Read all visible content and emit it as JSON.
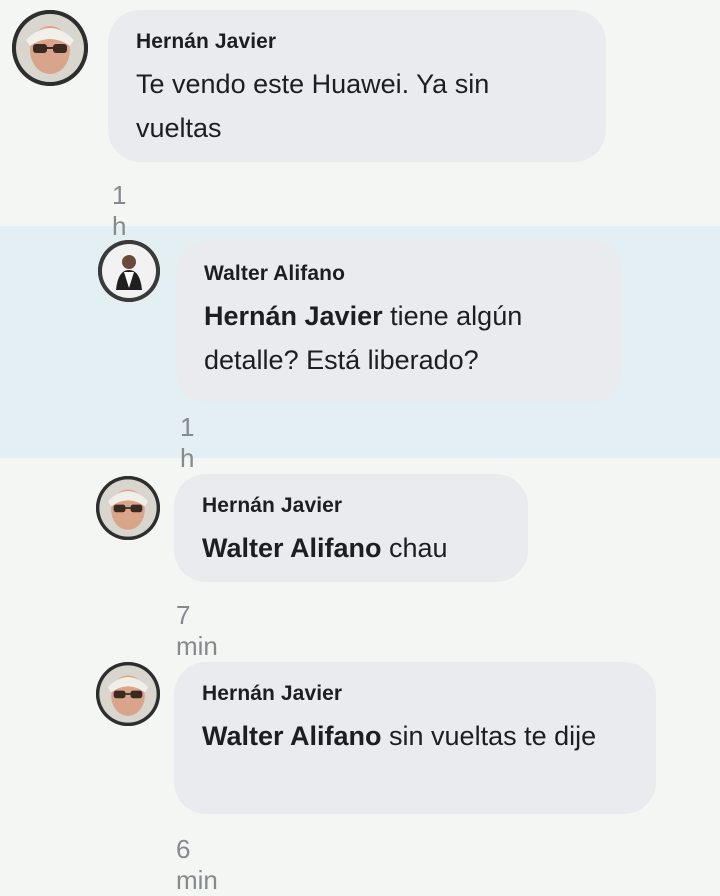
{
  "comments": [
    {
      "author": "Hernán Javier",
      "mention": "",
      "text": "Te vendo este Huawei. Ya sin vueltas",
      "time": "1 h"
    },
    {
      "author": "Walter Alifano",
      "mention": "Hernán Javier",
      "text": " tiene algún detalle? Está liberado?",
      "time": "1 h"
    },
    {
      "author": "Hernán Javier",
      "mention": "Walter Alifano",
      "text": " chau",
      "time": "7 min"
    },
    {
      "author": "Hernán Javier",
      "mention": "Walter Alifano",
      "text": " sin vueltas te dije",
      "time": "6 min"
    }
  ],
  "colors": {
    "background": "#f4f6f4",
    "highlight": "#e3eff2",
    "bubble": "#e9ebee",
    "timestamp": "#858a8f"
  }
}
